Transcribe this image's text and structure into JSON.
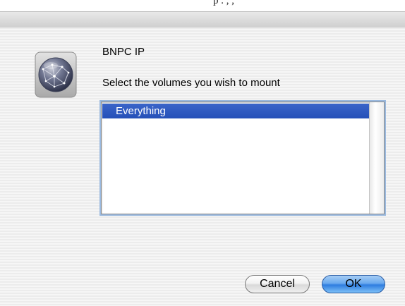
{
  "header": {
    "partial_text": "p         .      ,              ,"
  },
  "dialog": {
    "server_name": "BNPC IP",
    "prompt": "Select the volumes you wish to mount",
    "volumes": [
      "Everything"
    ],
    "selected_volume": "Everything",
    "buttons": {
      "cancel_label": "Cancel",
      "ok_label": "OK"
    },
    "icon": "network-globe-icon"
  }
}
